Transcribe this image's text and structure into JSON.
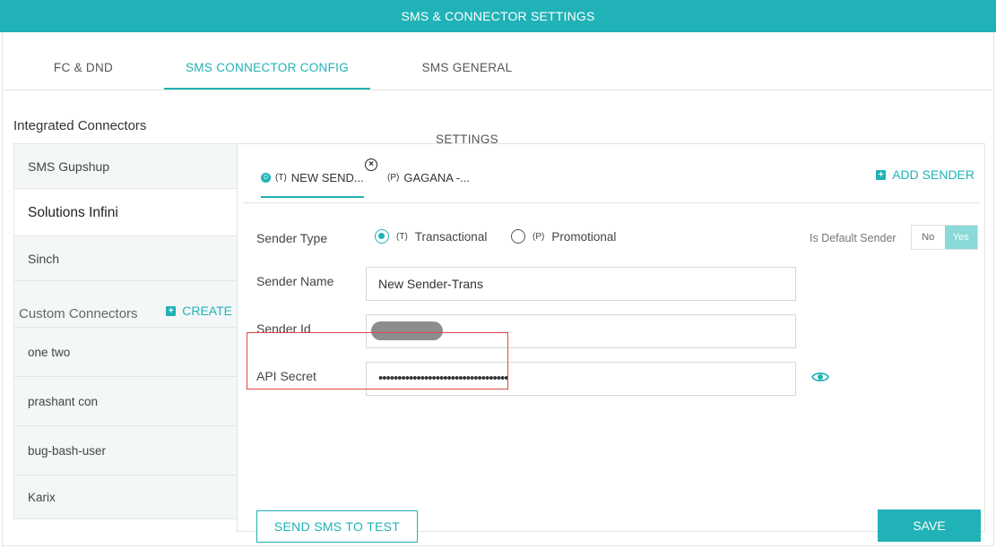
{
  "header": {
    "title": "SMS & CONNECTOR SETTINGS"
  },
  "tabs": [
    {
      "label": "FC & DND"
    },
    {
      "label": "SMS CONNECTOR CONFIG"
    },
    {
      "label": "SMS GENERAL SETTINGS"
    }
  ],
  "integrated": {
    "title": "Integrated Connectors",
    "items": [
      {
        "label": "SMS Gupshup"
      },
      {
        "label": "Solutions Infini"
      },
      {
        "label": "Sinch"
      }
    ]
  },
  "custom": {
    "title": "Custom Connectors",
    "create_label": "CREATE",
    "items": [
      {
        "label": "one two"
      },
      {
        "label": "prashant con"
      },
      {
        "label": "bug-bash-user"
      },
      {
        "label": "Karix"
      }
    ]
  },
  "sender_tabs": [
    {
      "badge": "D",
      "prefix": "(T)",
      "label": "NEW SEND..."
    },
    {
      "prefix": "(P)",
      "label": "GAGANA -..."
    }
  ],
  "add_sender_label": "ADD SENDER",
  "form": {
    "sender_type_label": "Sender Type",
    "radio_transactional": {
      "prefix": "(T)",
      "label": "Transactional"
    },
    "radio_promotional": {
      "prefix": "(P)",
      "label": "Promotional"
    },
    "default_sender_label": "Is Default Sender",
    "toggle_no": "No",
    "toggle_yes": "Yes",
    "sender_name_label": "Sender Name",
    "sender_name_value": "New Sender-Trans",
    "sender_id_label": "Sender Id",
    "api_secret_label": "API Secret",
    "api_secret_value": "••••••••••••••••••••••••••••••••••"
  },
  "buttons": {
    "send_test": "SEND SMS TO TEST",
    "save": "SAVE"
  },
  "colors": {
    "accent": "#20b2b6",
    "highlight_box": "#e04545"
  }
}
